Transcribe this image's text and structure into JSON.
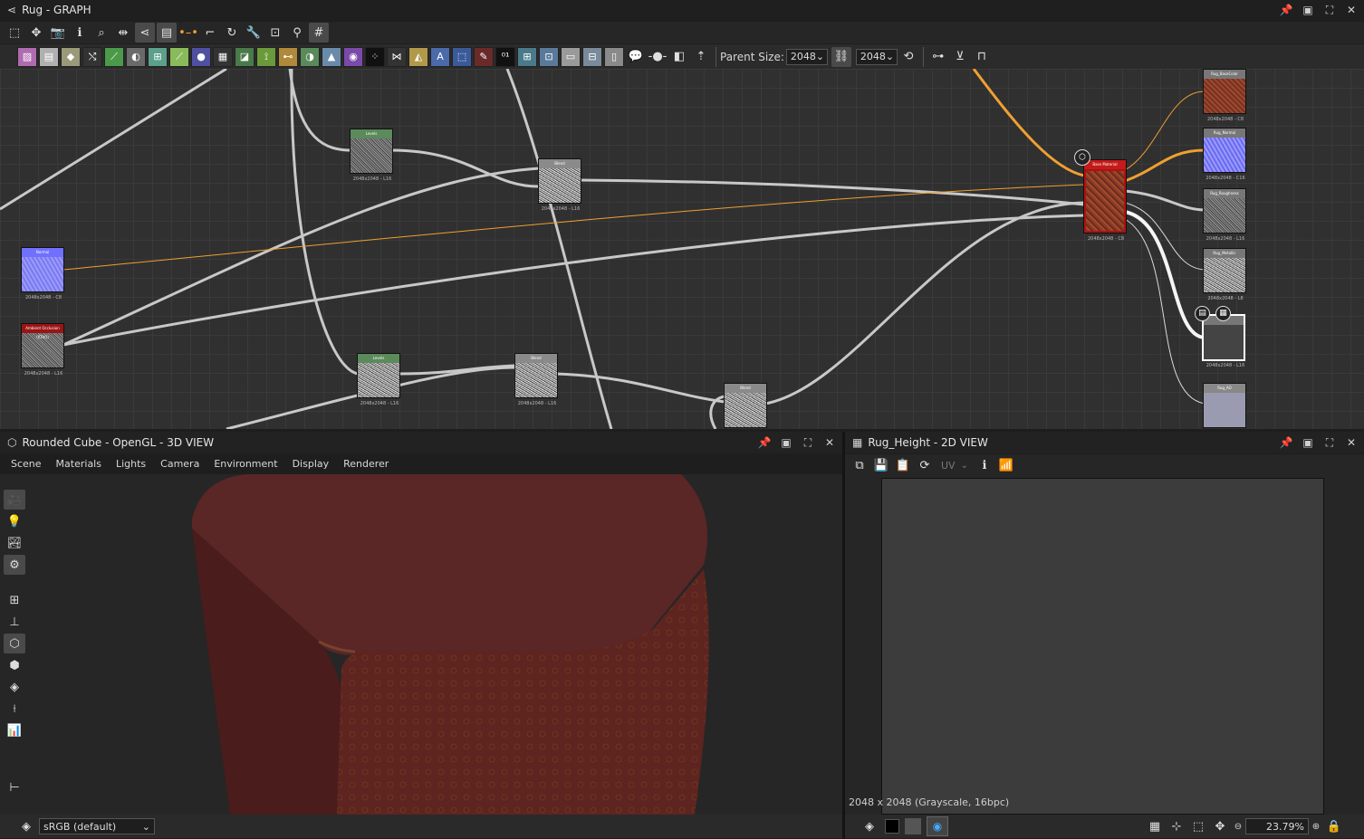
{
  "graph_window": {
    "title": "Rug - GRAPH"
  },
  "graph_toolbar": {
    "parent_size_label": "Parent Size:",
    "width_value": "2048",
    "height_value": "2048"
  },
  "nodes": [
    {
      "id": "levels1",
      "header": "Levels",
      "caption": "2048x2048 - L16"
    },
    {
      "id": "blend1",
      "header": "Blend",
      "caption": "2048x2048 - L16"
    },
    {
      "id": "normal",
      "header": "Normal",
      "caption": "2048x2048 - C8"
    },
    {
      "id": "ao",
      "header": "Ambient Occlusion (RTAO)",
      "caption": "2048x2048 - L16"
    },
    {
      "id": "levels2",
      "header": "Levels",
      "caption": "2048x2048 - L16"
    },
    {
      "id": "blend2",
      "header": "Blend",
      "caption": "2048x2048 - L16"
    },
    {
      "id": "blend3",
      "header": "Blend",
      "caption": ""
    },
    {
      "id": "basematerial",
      "header": "Base Material",
      "caption": "2048x2048 - C8"
    },
    {
      "id": "out_basecolor",
      "header": "Rug_BaseColor",
      "caption": "2048x2048 - C8"
    },
    {
      "id": "out_normal",
      "header": "Rug_Normal",
      "caption": "2048x2048 - C16"
    },
    {
      "id": "out_roughness",
      "header": "Rug_Roughness",
      "caption": "2048x2048 - L16"
    },
    {
      "id": "out_metallic",
      "header": "Rug_Metallic",
      "caption": "2048x2048 - L8"
    },
    {
      "id": "out_height",
      "header": "",
      "caption": "2048x2048 - L16"
    },
    {
      "id": "out_ao",
      "header": "Rug_AO",
      "caption": ""
    }
  ],
  "view3d": {
    "title": "Rounded Cube - OpenGL - 3D VIEW",
    "menus": [
      "Scene",
      "Materials",
      "Lights",
      "Camera",
      "Environment",
      "Display",
      "Renderer"
    ],
    "colorspace": "sRGB (default)"
  },
  "view2d": {
    "title": "Rug_Height - 2D VIEW",
    "uv_label": "UV",
    "info": "2048 x 2048 (Grayscale, 16bpc)",
    "zoom": "23.79%"
  },
  "colors": {
    "base_material_header": "#c41a1a",
    "levels_header": "#5b8a5b",
    "ao_header": "#9b1414",
    "normal_header": "#7070ff",
    "orange_wire": "#f0a030"
  }
}
